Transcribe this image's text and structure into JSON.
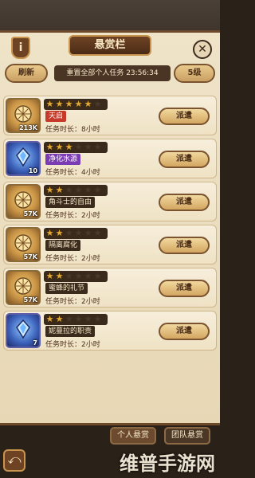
{
  "header": {
    "title": "悬赏栏",
    "info_label": "i",
    "close_label": "✕"
  },
  "toolbar": {
    "refresh_label": "刷新",
    "reset_text": "重置全部个人任务 23:56:34",
    "tier_label": "5级"
  },
  "quests": [
    {
      "name": "天启",
      "name_style": "red",
      "stars": 5,
      "max_stars": 6,
      "reward": "213K",
      "duration": "任务时长：8小时",
      "action": "派遣",
      "icon": "gold-sun-icon"
    },
    {
      "name": "净化水源",
      "name_style": "purple",
      "stars": 3,
      "max_stars": 6,
      "reward": "10",
      "duration": "任务时长：4小时",
      "action": "派遣",
      "icon": "blue-crystal-icon"
    },
    {
      "name": "角斗士的自由",
      "name_style": "dark",
      "stars": 2,
      "max_stars": 6,
      "reward": "57K",
      "duration": "任务时长：2小时",
      "action": "派遣",
      "icon": "gold-sun-icon"
    },
    {
      "name": "隔离腐化",
      "name_style": "dark",
      "stars": 2,
      "max_stars": 6,
      "reward": "57K",
      "duration": "任务时长：2小时",
      "action": "派遣",
      "icon": "gold-sun-icon"
    },
    {
      "name": "蜜蜂的礼节",
      "name_style": "dark",
      "stars": 2,
      "max_stars": 6,
      "reward": "57K",
      "duration": "任务时长：2小时",
      "action": "派遣",
      "icon": "gold-sun-icon"
    },
    {
      "name": "妮蔓拉的职责",
      "name_style": "dark",
      "stars": 2,
      "max_stars": 6,
      "reward": "7",
      "duration": "任务时长：2小时",
      "action": "派遣",
      "icon": "blue-crystal-icon"
    }
  ],
  "tabs": {
    "personal": "个人悬赏",
    "team": "团队悬赏"
  },
  "footer": {
    "back_label": "⤺",
    "watermark": "维普手游网"
  },
  "colors": {
    "panel": "#efe3c8",
    "border": "#6d4a2b",
    "gold": "#e4a92d",
    "accent_red": "#c63a2a",
    "accent_purple": "#7a3bb3"
  }
}
